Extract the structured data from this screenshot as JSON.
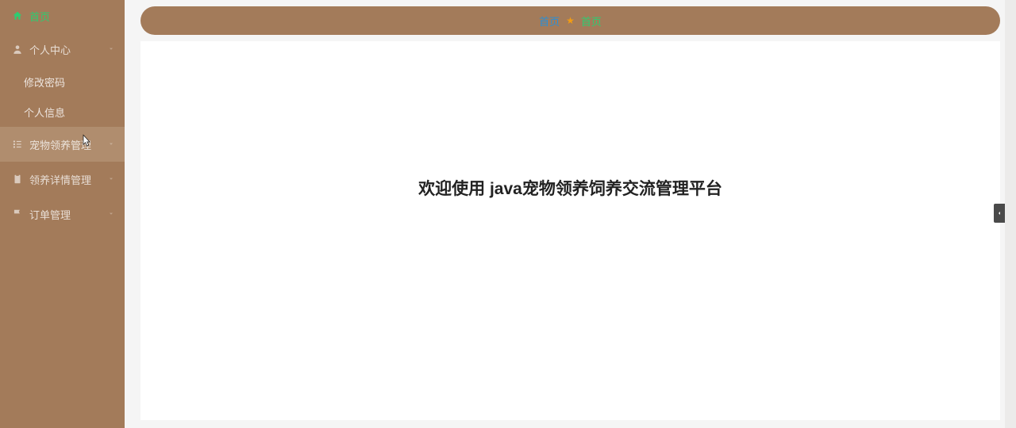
{
  "sidebar": {
    "home": {
      "label": "首页"
    },
    "personal_center": {
      "label": "个人中心"
    },
    "change_password": {
      "label": "修改密码"
    },
    "personal_info": {
      "label": "个人信息"
    },
    "pet_adoption_mgmt": {
      "label": "宠物领养管理"
    },
    "adoption_detail_mgmt": {
      "label": "领养详情管理"
    },
    "order_mgmt": {
      "label": "订单管理"
    }
  },
  "breadcrumb": {
    "root": "首页",
    "current": "首页"
  },
  "main": {
    "welcome": "欢迎使用 java宠物领养饲养交流管理平台"
  }
}
